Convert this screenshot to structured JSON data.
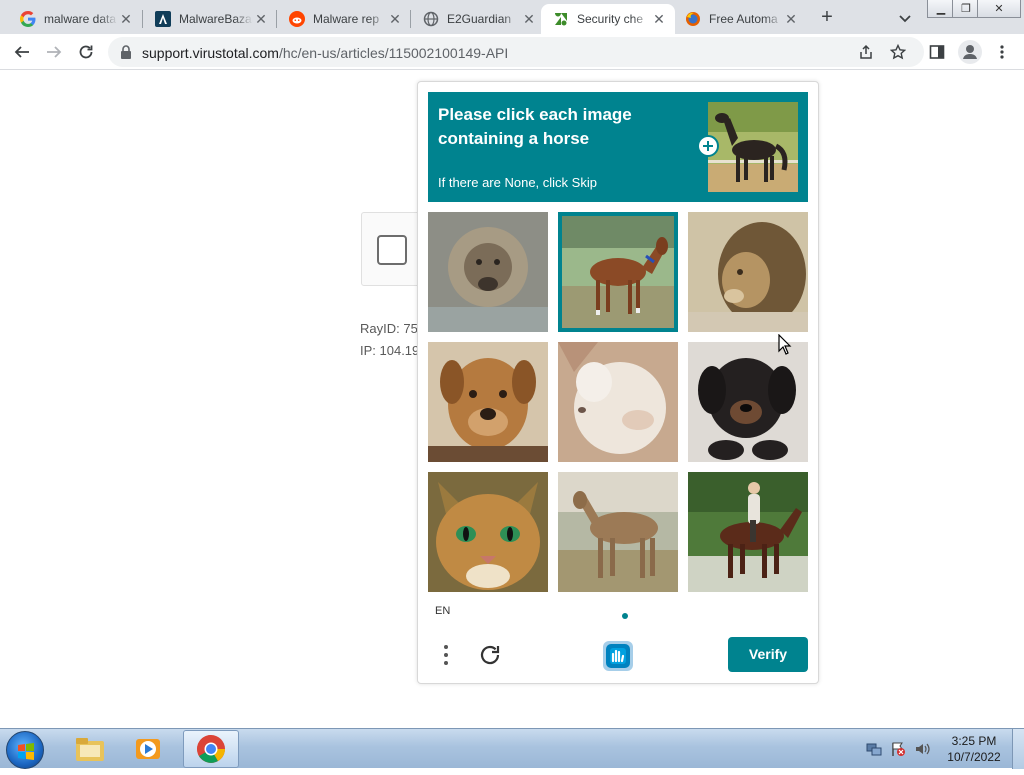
{
  "browser": {
    "tabs": [
      {
        "title": "malware data",
        "icon": "google-icon",
        "active": false
      },
      {
        "title": "MalwareBazaar",
        "icon": "malwarebazaar-icon",
        "active": false
      },
      {
        "title": "Malware rep",
        "icon": "reddit-icon",
        "active": false
      },
      {
        "title": "E2Guardian",
        "icon": "globe-icon",
        "active": false
      },
      {
        "title": "Security che",
        "icon": "zendesk-icon",
        "active": true
      },
      {
        "title": "Free Automa",
        "icon": "firefox-icon",
        "active": false
      }
    ],
    "new_tab": "+",
    "url_domain": "support.virustotal.com",
    "url_path": "/hc/en-us/articles/115002100149-API"
  },
  "page": {
    "ray_id": "RayID: 75",
    "ip": "IP: 104.19"
  },
  "captcha": {
    "prompt_title": "Please click each image containing a horse",
    "prompt_subtitle": "If there are None, click Skip",
    "example_icon": "horse-example-image",
    "images": [
      {
        "subject": "lion",
        "selected": false
      },
      {
        "subject": "horse",
        "selected": true
      },
      {
        "subject": "lion",
        "selected": false
      },
      {
        "subject": "dog",
        "selected": false
      },
      {
        "subject": "cat",
        "selected": false
      },
      {
        "subject": "puppy",
        "selected": false
      },
      {
        "subject": "cat",
        "selected": false
      },
      {
        "subject": "horse",
        "selected": false
      },
      {
        "subject": "horse-with-rider",
        "selected": false
      }
    ],
    "language": "EN",
    "verify_label": "Verify",
    "accent_color": "#00838f"
  },
  "taskbar": {
    "time": "3:25 PM",
    "date": "10/7/2022"
  }
}
